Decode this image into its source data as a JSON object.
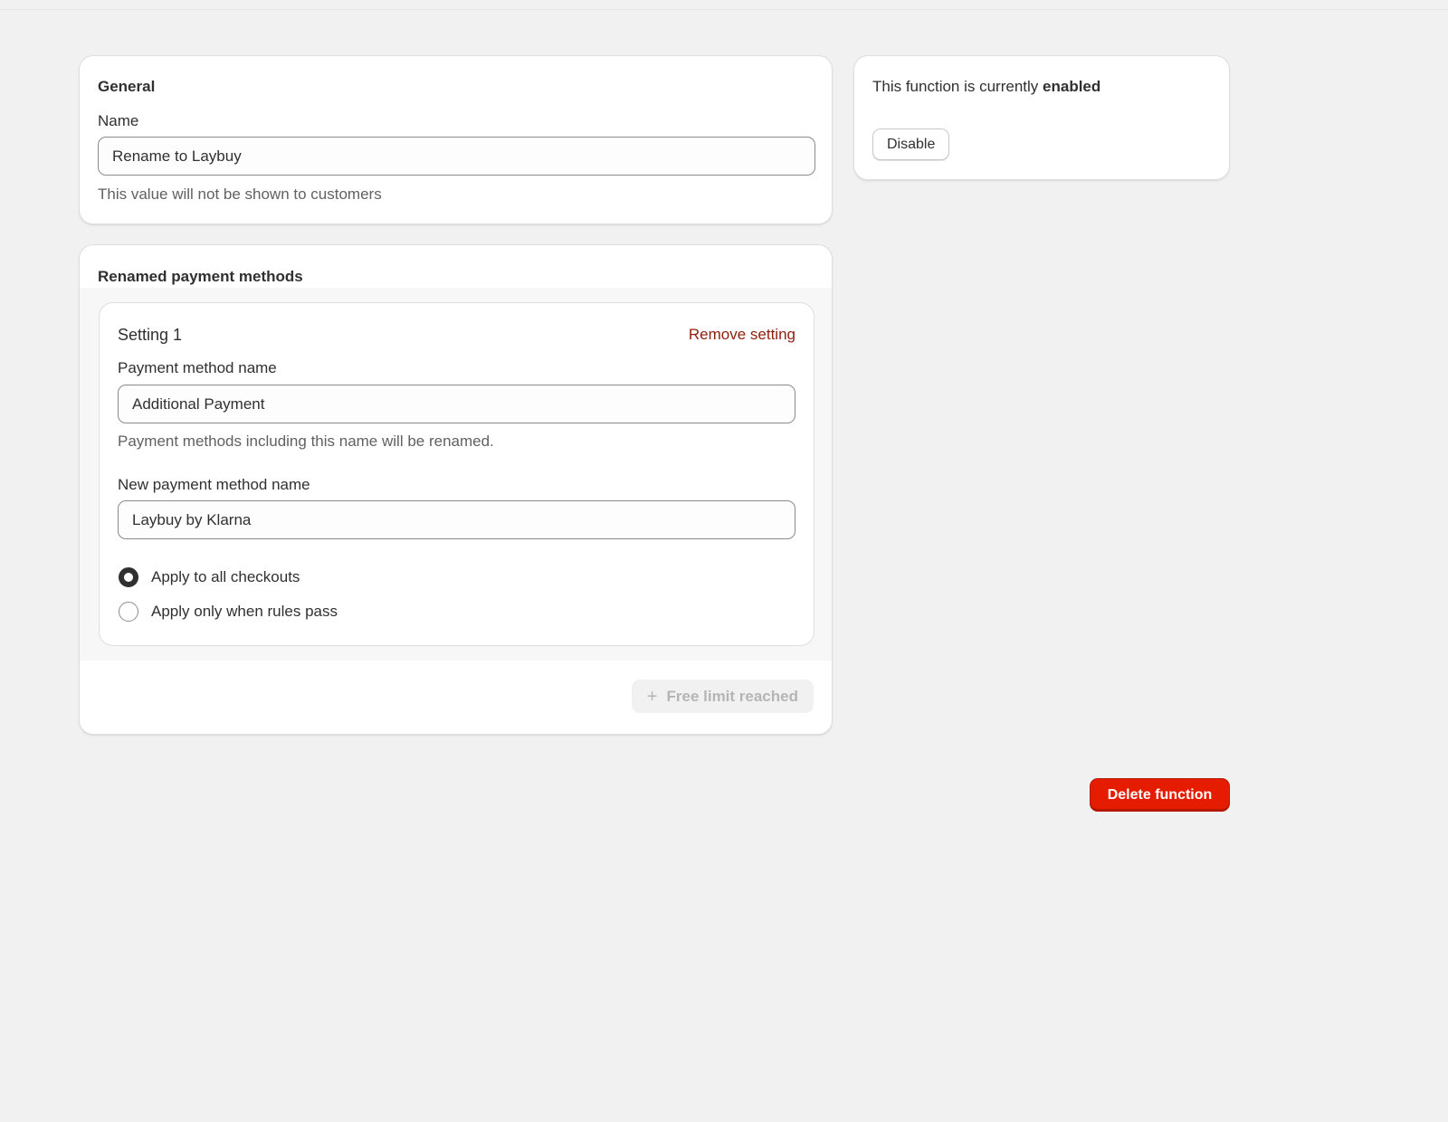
{
  "general": {
    "title": "General",
    "name_label": "Name",
    "name_value": "Rename to Laybuy",
    "name_help": "This value will not be shown to customers"
  },
  "renamed": {
    "title": "Renamed payment methods",
    "setting": {
      "title": "Setting 1",
      "remove_label": "Remove setting",
      "payment_method_label": "Payment method name",
      "payment_method_value": "Additional Payment",
      "payment_method_help": "Payment methods including this name will be renamed.",
      "new_name_label": "New payment method name",
      "new_name_value": "Laybuy by Klarna",
      "radio_options": [
        {
          "label": "Apply to all checkouts",
          "checked": true
        },
        {
          "label": "Apply only when rules pass",
          "checked": false
        }
      ]
    },
    "add_button": {
      "icon": "plus-icon",
      "label": "Free limit reached"
    }
  },
  "status": {
    "text": "This function is currently",
    "state": "enabled",
    "disable_label": "Disable"
  },
  "delete_label": "Delete function",
  "colors": {
    "critical": "#e51c00",
    "critical_text": "#8e1f0b",
    "background": "#f1f1f1"
  }
}
